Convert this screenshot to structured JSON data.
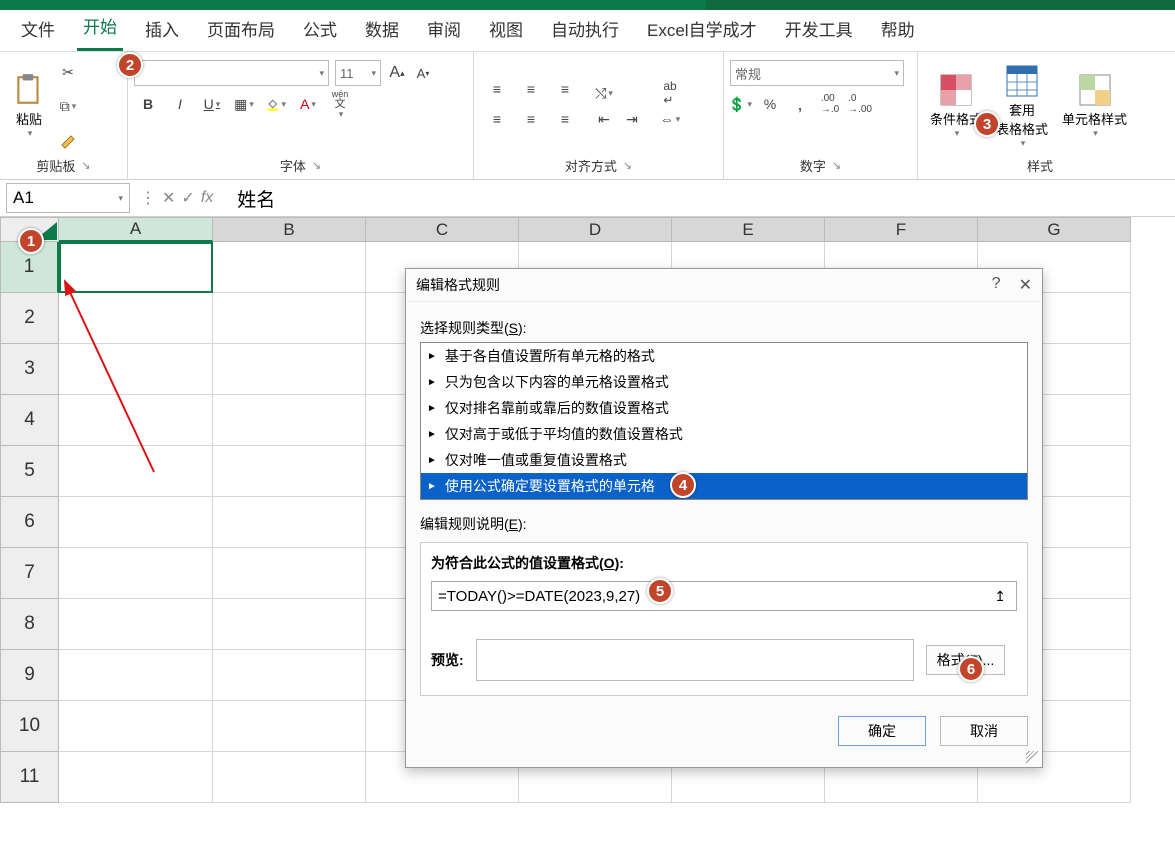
{
  "tabs": {
    "file": "文件",
    "home": "开始",
    "insert": "插入",
    "pagelayout": "页面布局",
    "formulas": "公式",
    "data": "数据",
    "review": "审阅",
    "view": "视图",
    "automate": "自动执行",
    "custom1": "Excel自学成才",
    "developer": "开发工具",
    "help": "帮助"
  },
  "ribbon": {
    "clipboard": {
      "paste": "粘贴",
      "label": "剪贴板"
    },
    "font": {
      "size": "11",
      "label": "字体",
      "wen": "wén"
    },
    "alignment": {
      "label": "对齐方式"
    },
    "number": {
      "general": "常规",
      "label": "数字"
    },
    "styles": {
      "cond": "条件格式",
      "table": "套用\n表格格式",
      "cell": "单元格样式",
      "label": "样式"
    }
  },
  "formula_bar": {
    "namebox": "A1",
    "value": "姓名"
  },
  "columns": [
    "A",
    "B",
    "C",
    "D",
    "E",
    "F",
    "G"
  ],
  "rows": [
    "1",
    "2",
    "3",
    "4",
    "5",
    "6",
    "7",
    "8",
    "9",
    "10",
    "11"
  ],
  "dialog": {
    "title": "编辑格式规则",
    "select_label_pre": "选择规则类型(",
    "select_label_key": "S",
    "select_label_post": "):",
    "rules": [
      "基于各自值设置所有单元格的格式",
      "只为包含以下内容的单元格设置格式",
      "仅对排名靠前或靠后的数值设置格式",
      "仅对高于或低于平均值的数值设置格式",
      "仅对唯一值或重复值设置格式",
      "使用公式确定要设置格式的单元格"
    ],
    "desc_label_pre": "编辑规则说明(",
    "desc_label_key": "E",
    "desc_label_post": "):",
    "formula_hdr_pre": "为符合此公式的值设置格式(",
    "formula_hdr_key": "O",
    "formula_hdr_post": "):",
    "formula_value": "=TODAY()>=DATE(2023,9,27)",
    "preview_label": "预览:",
    "format_btn_pre": "格式(",
    "format_btn_key": "F",
    "format_btn_post": ")...",
    "ok": "确定",
    "cancel": "取消"
  },
  "callouts": {
    "c1": "1",
    "c2": "2",
    "c3": "3",
    "c4": "4",
    "c5": "5",
    "c6": "6"
  }
}
